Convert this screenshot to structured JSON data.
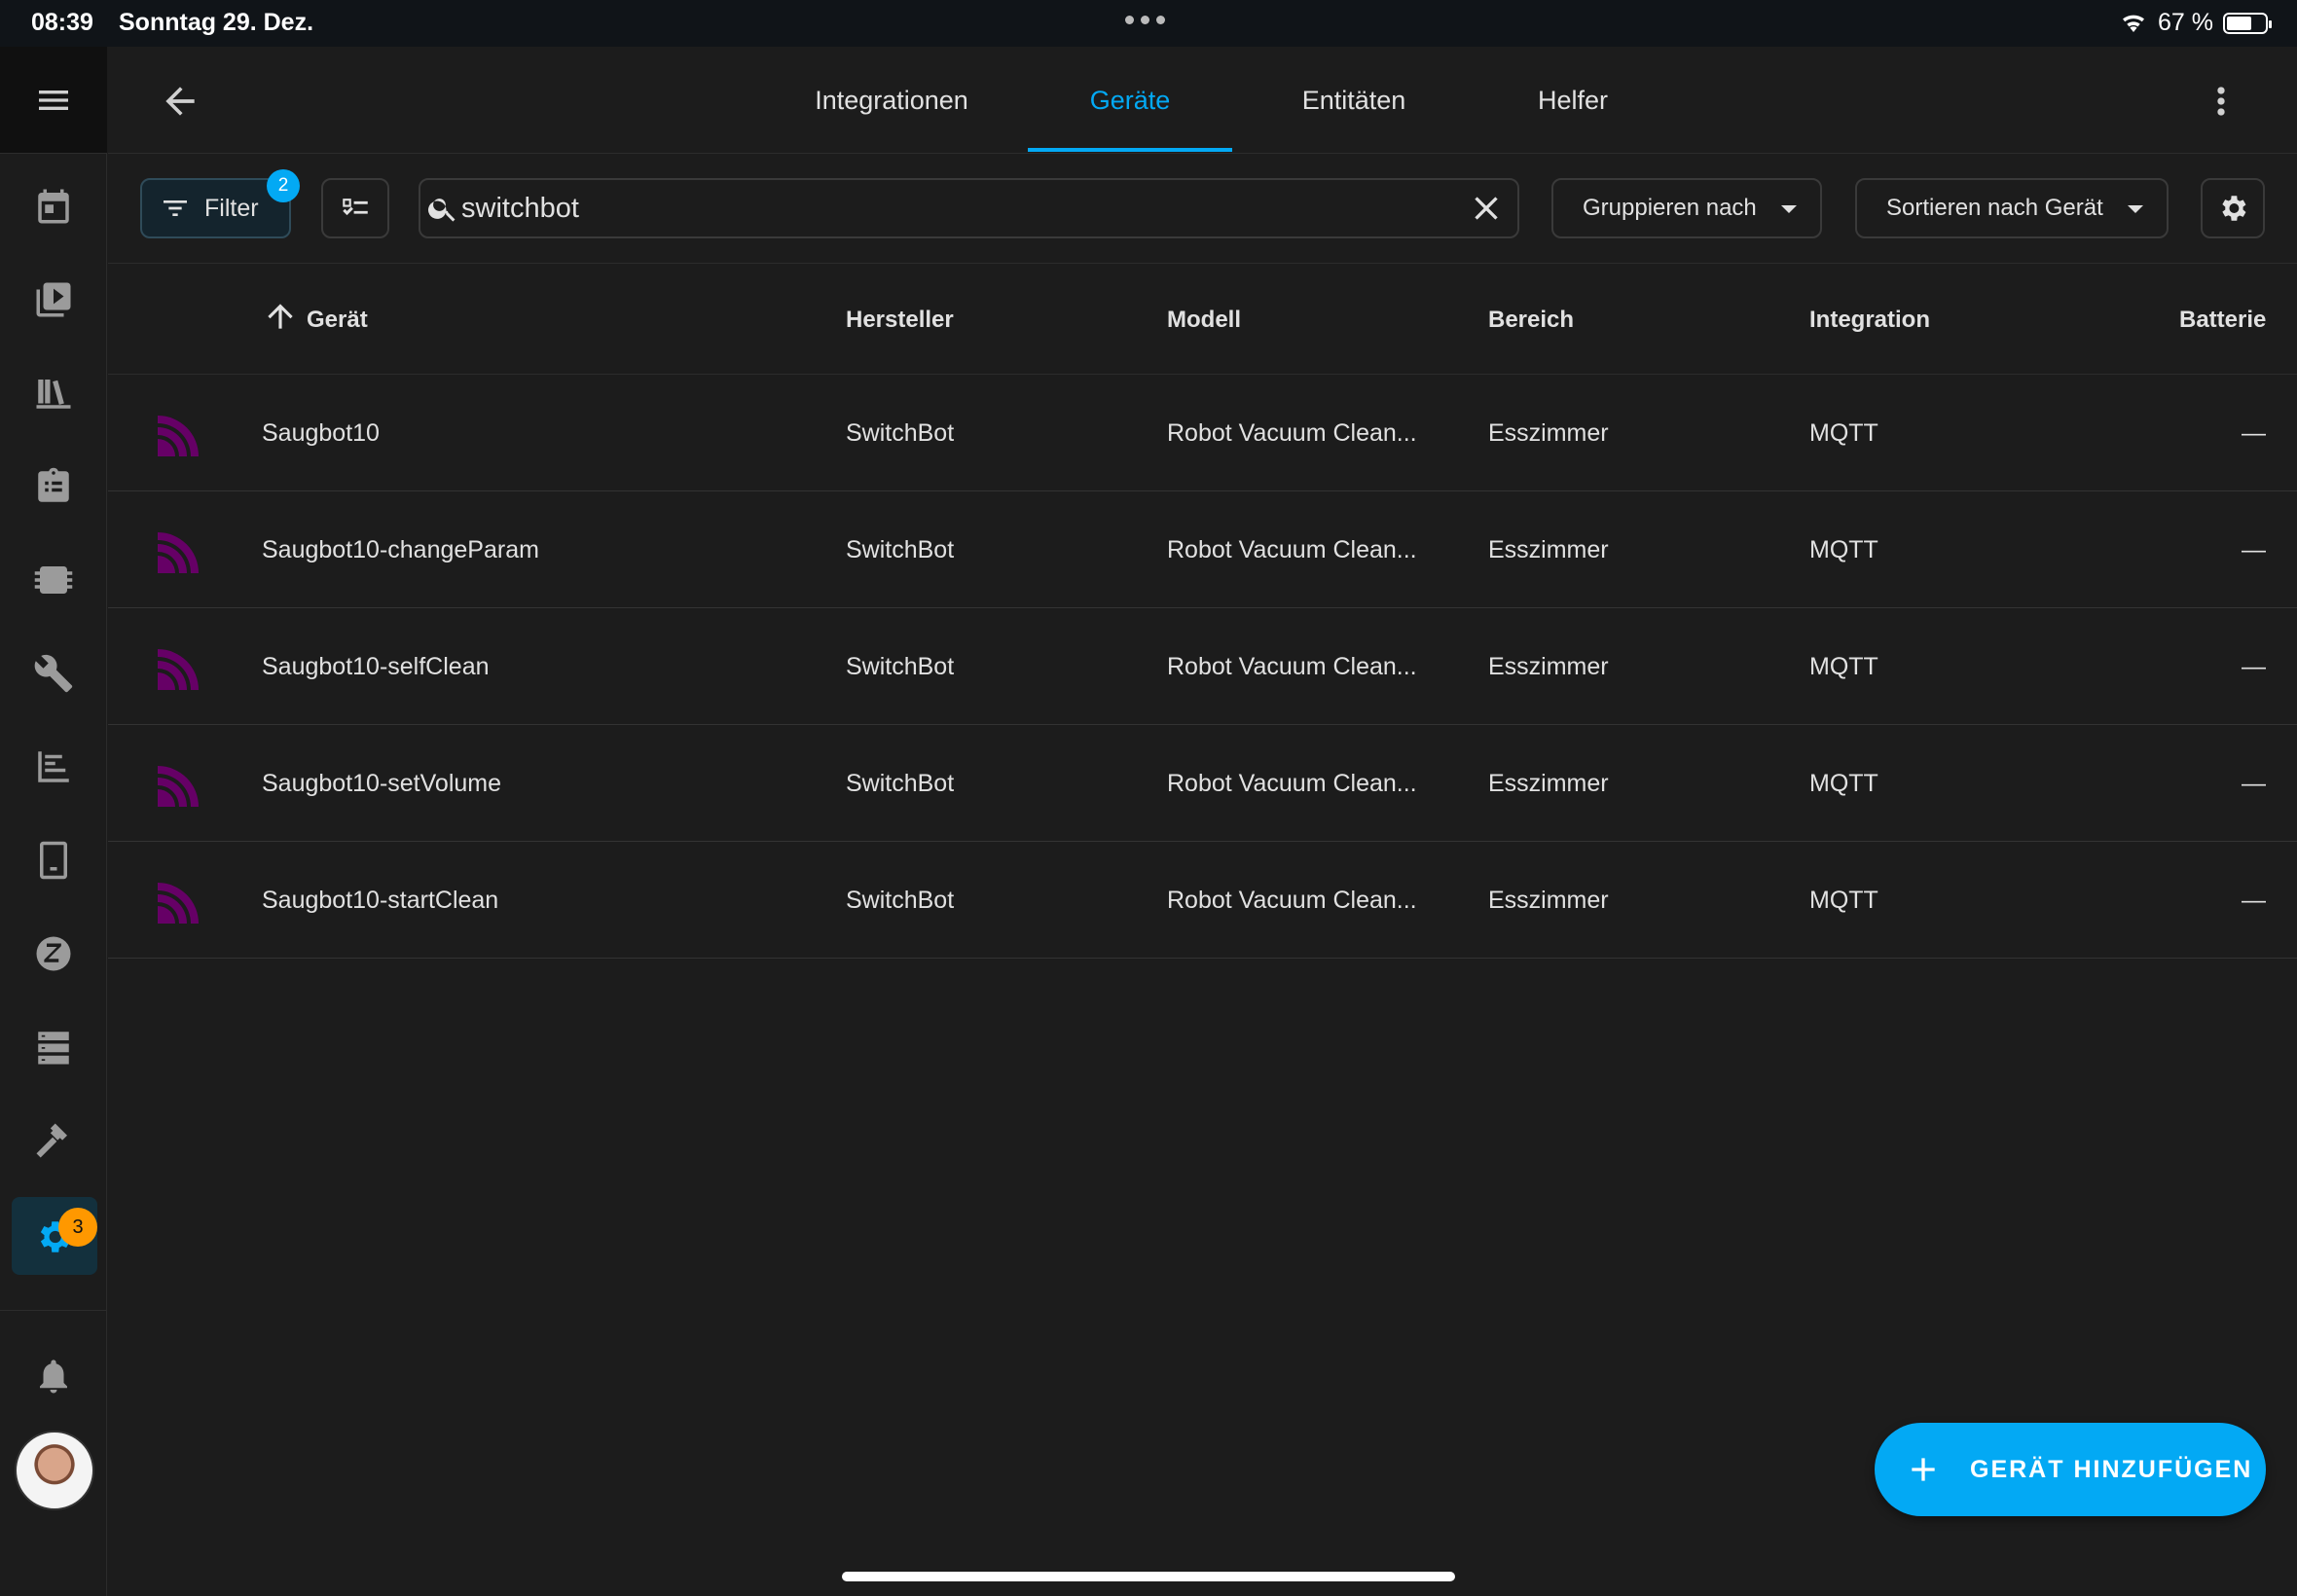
{
  "status_bar": {
    "time": "08:39",
    "date": "Sonntag 29. Dez.",
    "battery": "67 %",
    "battery_level": 0.67
  },
  "sidebar": {
    "items": [
      {
        "icon": "calendar-icon"
      },
      {
        "icon": "media-icon"
      },
      {
        "icon": "library-icon"
      },
      {
        "icon": "clipboard-list-icon"
      },
      {
        "icon": "chip-icon"
      },
      {
        "icon": "wrench-icon"
      },
      {
        "icon": "logbook-icon"
      },
      {
        "icon": "tablet-icon"
      },
      {
        "icon": "zwave-icon"
      },
      {
        "icon": "server-icon"
      },
      {
        "icon": "hammer-icon"
      },
      {
        "icon": "settings-icon",
        "badge": "3",
        "active": true
      }
    ],
    "notifications_icon": "bell-icon"
  },
  "tabs": [
    {
      "label": "Integrationen"
    },
    {
      "label": "Geräte",
      "active": true
    },
    {
      "label": "Entitäten"
    },
    {
      "label": "Helfer"
    }
  ],
  "toolbar": {
    "filter_label": "Filter",
    "filter_count": "2",
    "search_value": "switchbot",
    "group_label": "Gruppieren nach",
    "sort_label": "Sortieren nach Gerät"
  },
  "table": {
    "columns": [
      "Gerät",
      "Hersteller",
      "Modell",
      "Bereich",
      "Integration",
      "Batterie"
    ],
    "rows": [
      {
        "name": "Saugbot10",
        "manufacturer": "SwitchBot",
        "model": "Robot Vacuum Clean...",
        "area": "Esszimmer",
        "integration": "MQTT",
        "battery": "—"
      },
      {
        "name": "Saugbot10-changeParam",
        "manufacturer": "SwitchBot",
        "model": "Robot Vacuum Clean...",
        "area": "Esszimmer",
        "integration": "MQTT",
        "battery": "—"
      },
      {
        "name": "Saugbot10-selfClean",
        "manufacturer": "SwitchBot",
        "model": "Robot Vacuum Clean...",
        "area": "Esszimmer",
        "integration": "MQTT",
        "battery": "—"
      },
      {
        "name": "Saugbot10-setVolume",
        "manufacturer": "SwitchBot",
        "model": "Robot Vacuum Clean...",
        "area": "Esszimmer",
        "integration": "MQTT",
        "battery": "—"
      },
      {
        "name": "Saugbot10-startClean",
        "manufacturer": "SwitchBot",
        "model": "Robot Vacuum Clean...",
        "area": "Esszimmer",
        "integration": "MQTT",
        "battery": "—"
      }
    ]
  },
  "fab": {
    "label": "GERÄT HINZUFÜGEN"
  },
  "colors": {
    "accent": "#03a9f4",
    "badge": "#ff9800",
    "mqtt_icon": "#660066"
  }
}
